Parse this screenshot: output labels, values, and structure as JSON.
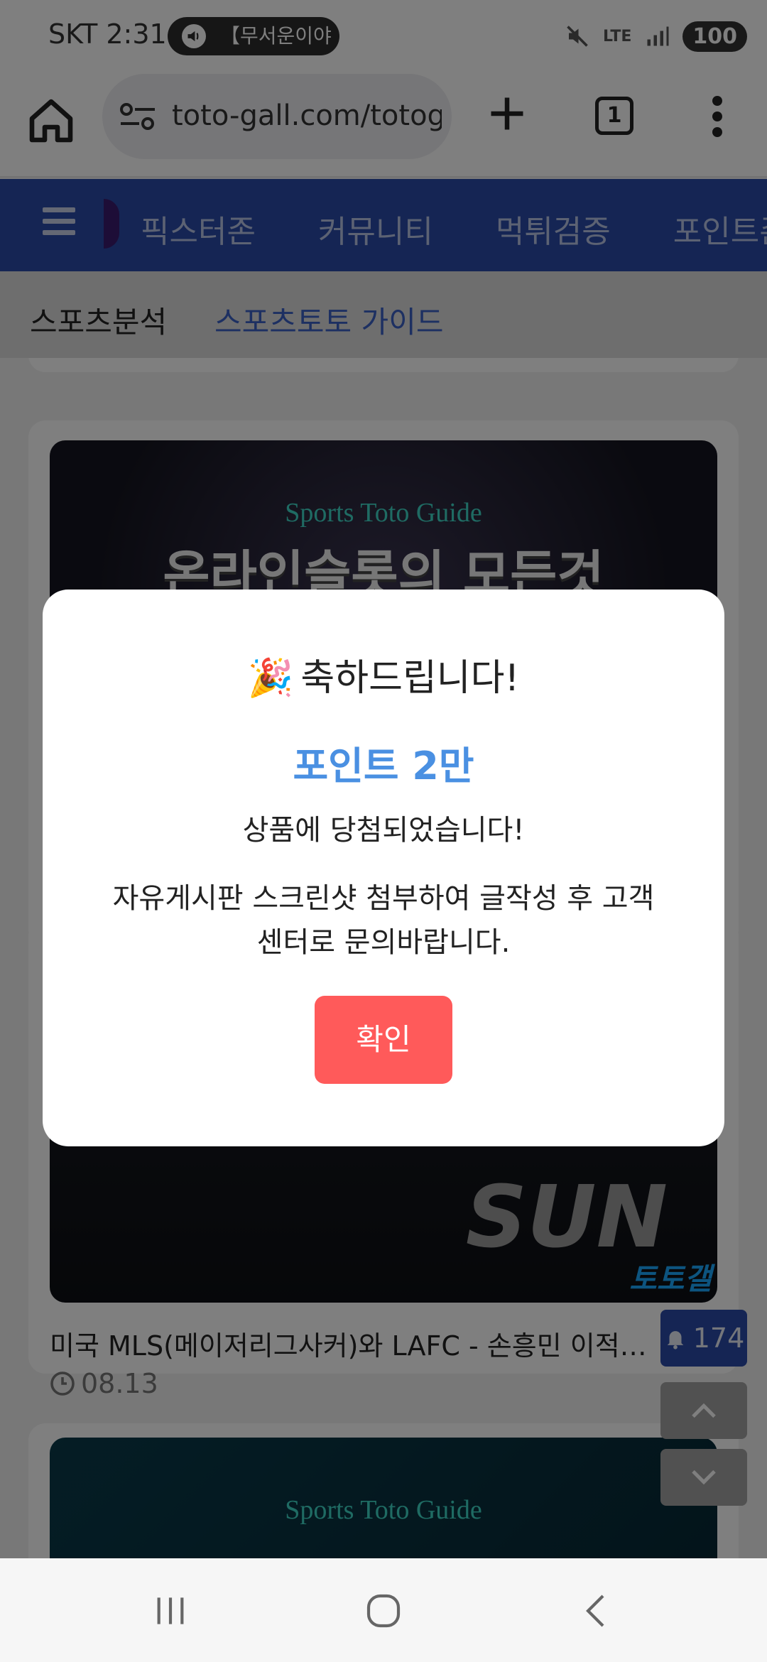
{
  "status_bar": {
    "carrier_time": "SKT 2:31",
    "media_text": "【무서운이야",
    "network": "LTE",
    "battery": "100"
  },
  "browser": {
    "url": "toto-gall.com/totog",
    "tab_count": "1"
  },
  "site_nav": {
    "items": [
      "픽스터존",
      "커뮤니티",
      "먹튀검증",
      "포인트존"
    ]
  },
  "sub_nav": {
    "item1": "스포츠분석",
    "item2": "스포츠토토 가이드"
  },
  "cards": {
    "card1": {
      "guide_label": "Sports Toto Guide",
      "thumb_title": "온라인슬롯의 모든것"
    },
    "card2": {
      "thumb_text": "SUN",
      "badge": "토토갤",
      "title": "미국 MLS(메이저리그사커)와 LAFC - 손흥민 이적…",
      "date": "08.13"
    },
    "card3": {
      "guide_label": "Sports Toto Guide"
    }
  },
  "floating": {
    "notification_count": "174"
  },
  "modal": {
    "title": "축하드립니다!",
    "prize": "포인트 2만",
    "won_text": "상품에 당첨되었습니다!",
    "instructions": "자유게시판 스크린샷 첨부하여 글작성 후 고객센터로 문의바랍니다.",
    "confirm_label": "확인"
  },
  "colors": {
    "nav_blue": "#2a4ba8",
    "prize_blue": "#4a90e2",
    "confirm_red": "#ff5a5a"
  }
}
